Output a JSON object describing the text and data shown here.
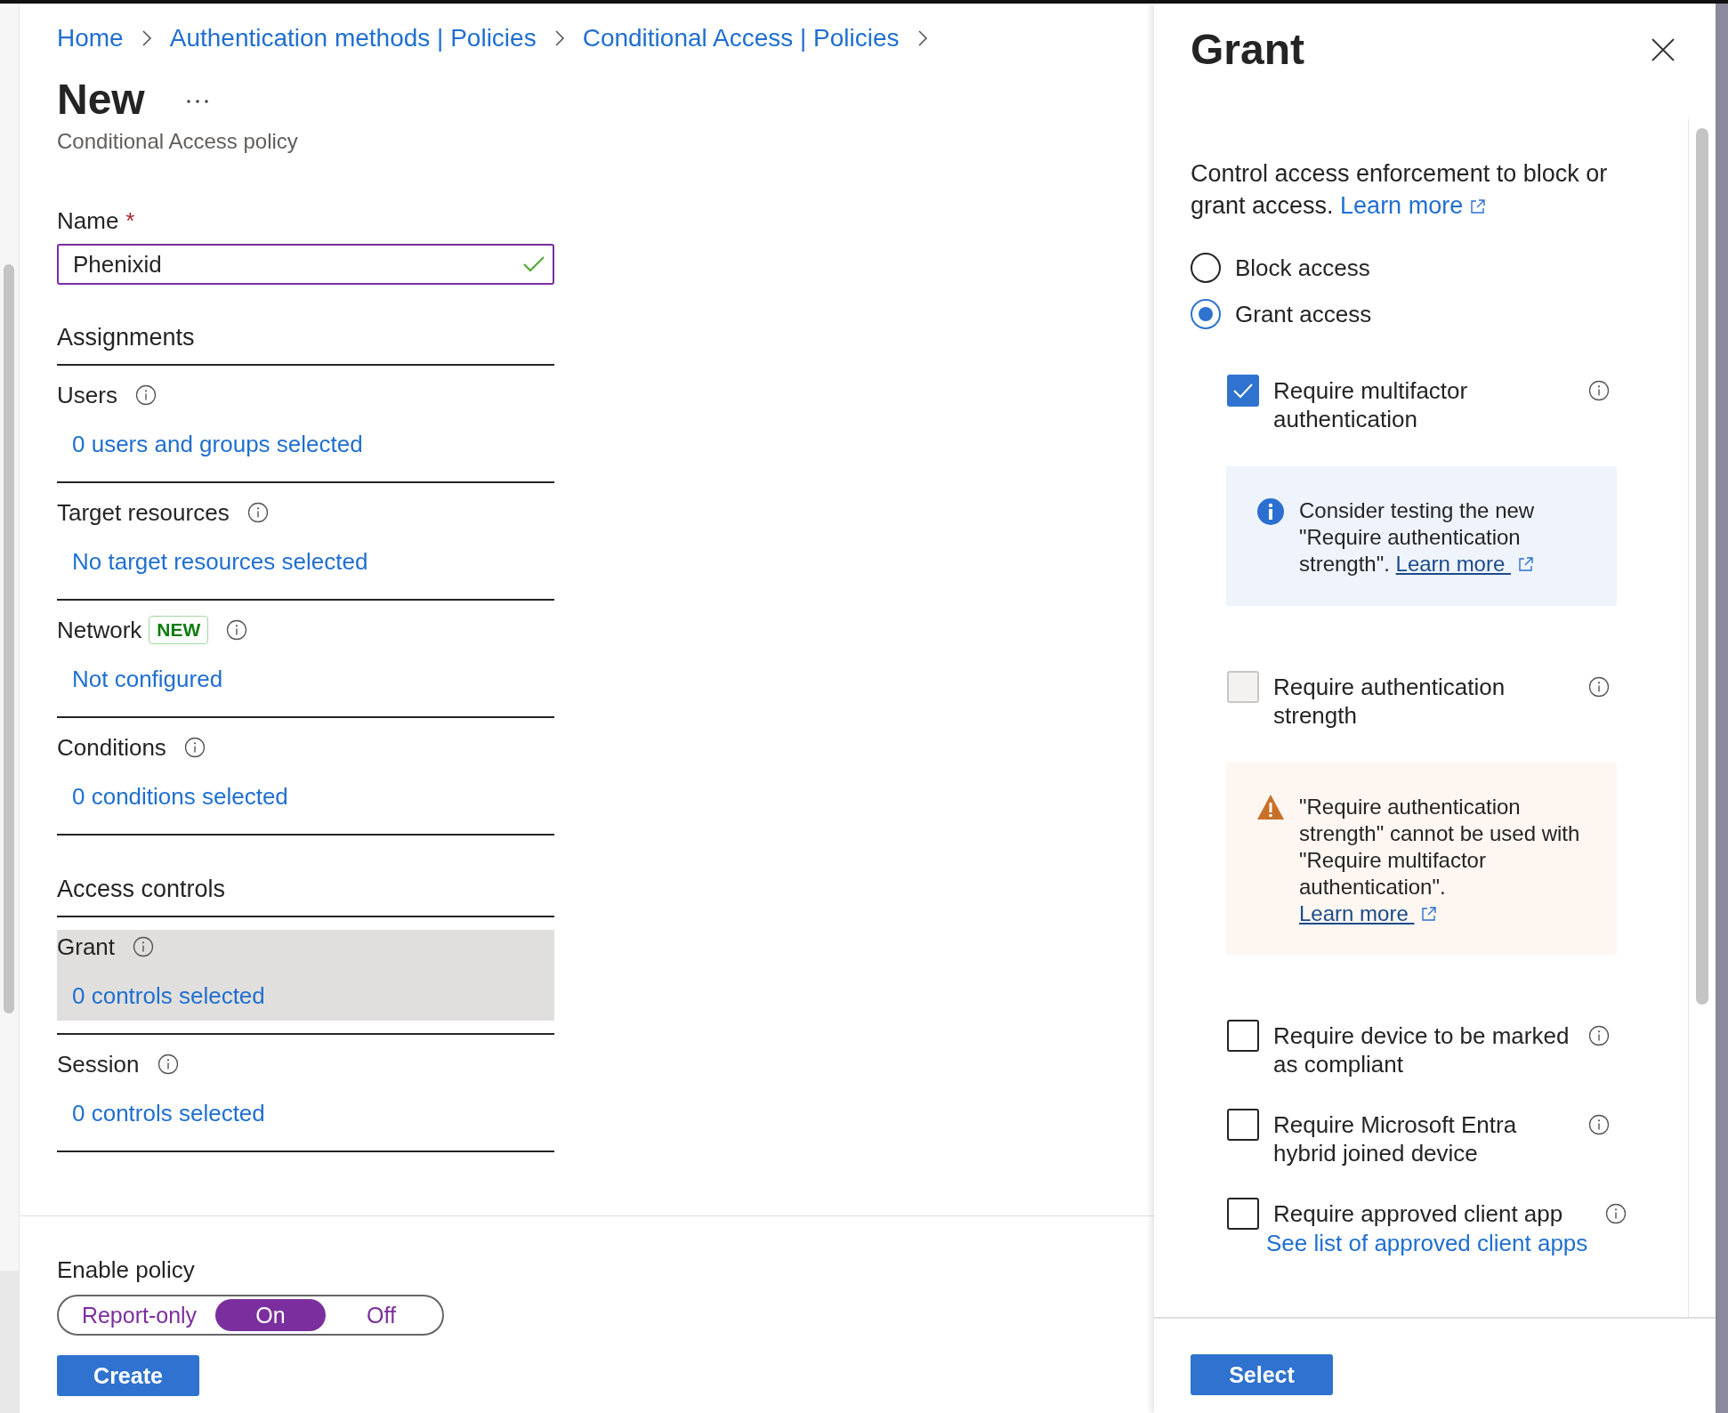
{
  "breadcrumb": [
    "Home",
    "Authentication methods | Policies",
    "Conditional Access | Policies"
  ],
  "page": {
    "title": "New",
    "subtitle": "Conditional Access policy"
  },
  "name_field": {
    "label": "Name",
    "required_mark": "*",
    "value": "Phenixid",
    "valid": true
  },
  "sections": [
    {
      "heading": "Assignments",
      "items": [
        {
          "label": "Users",
          "link": "0 users and groups selected",
          "selected": false
        },
        {
          "label": "Target resources",
          "link": "No target resources selected",
          "selected": false
        },
        {
          "label": "Network",
          "badge": "NEW",
          "link": "Not configured",
          "selected": false
        },
        {
          "label": "Conditions",
          "link": "0 conditions selected",
          "selected": false
        }
      ]
    },
    {
      "heading": "Access controls",
      "items": [
        {
          "label": "Grant",
          "link": "0 controls selected",
          "selected": true
        },
        {
          "label": "Session",
          "link": "0 controls selected",
          "selected": false
        }
      ]
    }
  ],
  "enable_policy": {
    "label": "Enable policy",
    "options": [
      {
        "label": "Report-only",
        "selected": false
      },
      {
        "label": "On",
        "selected": true
      },
      {
        "label": "Off",
        "selected": false
      }
    ]
  },
  "create_button": "Create",
  "panel": {
    "title": "Grant",
    "description": "Control access enforcement to block or grant access.",
    "learn_more": "Learn more",
    "access_options": [
      {
        "label": "Block access",
        "selected": false
      },
      {
        "label": "Grant access",
        "selected": true
      }
    ],
    "controls": [
      {
        "kind": "checkbox",
        "label": "Require multifactor authentication",
        "checked": true,
        "disabled": false
      },
      {
        "kind": "info_notice",
        "text": "Consider testing the new \"Require authentication strength\".",
        "link": "Learn more",
        "link_break": false
      },
      {
        "kind": "checkbox",
        "label": "Require authentication strength",
        "checked": false,
        "disabled": true
      },
      {
        "kind": "warning_notice",
        "text": "\"Require authentication strength\" cannot be used with \"Require multifactor authentication\".",
        "link": "Learn more",
        "link_break": true
      },
      {
        "kind": "checkbox",
        "label": "Require device to be marked as compliant",
        "checked": false,
        "disabled": false
      },
      {
        "kind": "checkbox",
        "label": "Require Microsoft Entra hybrid joined device",
        "checked": false,
        "disabled": false
      },
      {
        "kind": "checkbox",
        "label": "Require approved client app",
        "checked": false,
        "disabled": false,
        "link": "See list of approved client apps"
      }
    ],
    "select_button": "Select"
  }
}
